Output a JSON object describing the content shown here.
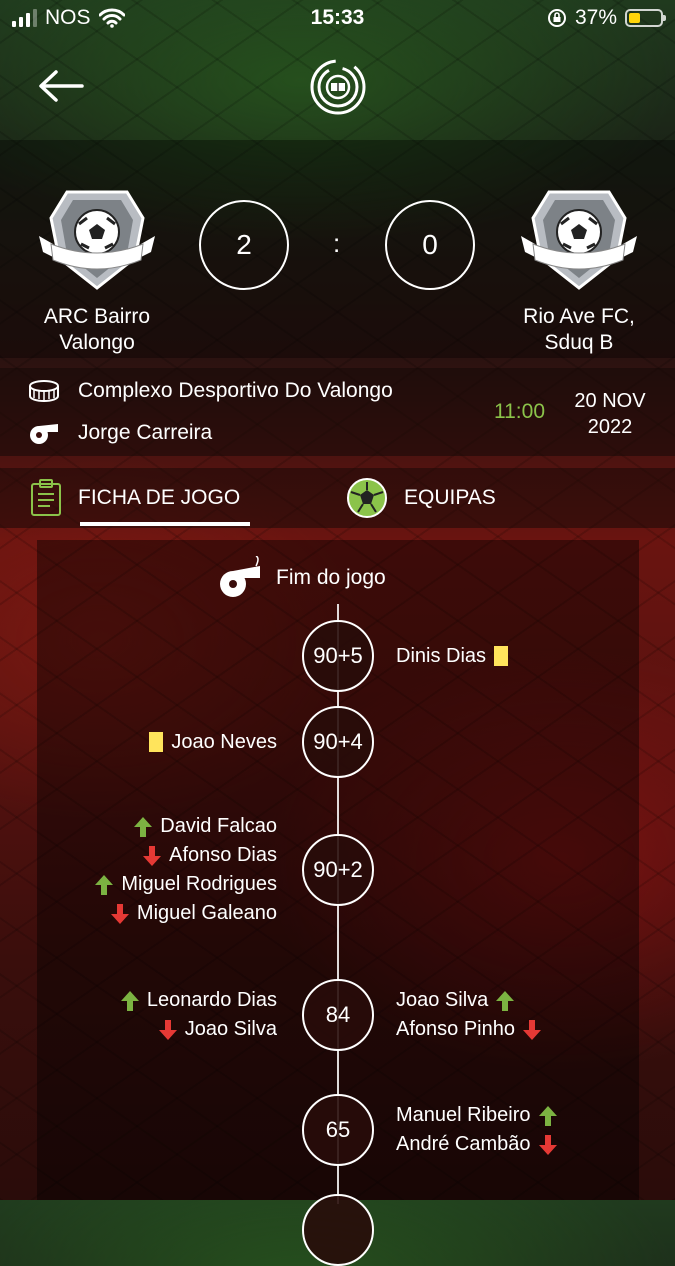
{
  "status_bar": {
    "carrier": "NOS",
    "time": "15:33",
    "battery_percent": "37%",
    "battery_level": 0.37
  },
  "header": {
    "back_icon": "arrow-left-icon",
    "logo_icon": "app-logo-icon"
  },
  "match": {
    "home_team": {
      "line1": "ARC Bairro",
      "line2": "Valongo",
      "score": "2"
    },
    "away_team": {
      "line1": "Rio Ave FC,",
      "line2": "Sduq B",
      "score": "0"
    },
    "separator": ":"
  },
  "info": {
    "venue": "Complexo Desportivo Do Valongo",
    "referee": "Jorge Carreira",
    "kickoff": "11:00",
    "date_line1": "20 NOV",
    "date_line2": "2022"
  },
  "tabs": [
    {
      "label": "FICHA DE JOGO",
      "icon": "clipboard-icon",
      "active": true
    },
    {
      "label": "EQUIPAS",
      "icon": "soccer-ball-icon",
      "active": false
    }
  ],
  "timeline": {
    "end_label": "Fim do jogo",
    "events": [
      {
        "minute": "90+5",
        "right": [
          {
            "name": "Dinis Dias",
            "type": "yellow-card"
          }
        ],
        "left": []
      },
      {
        "minute": "90+4",
        "left": [
          {
            "name": "Joao Neves",
            "type": "yellow-card"
          }
        ],
        "right": []
      },
      {
        "minute": "90+2",
        "left": [
          {
            "name": "David Falcao",
            "type": "sub-in"
          },
          {
            "name": "Afonso Dias",
            "type": "sub-out"
          },
          {
            "name": "Miguel Rodrigues",
            "type": "sub-in"
          },
          {
            "name": "Miguel Galeano",
            "type": "sub-out"
          }
        ],
        "right": []
      },
      {
        "minute": "84",
        "left": [
          {
            "name": "Leonardo Dias",
            "type": "sub-in"
          },
          {
            "name": "Joao Silva",
            "type": "sub-out"
          }
        ],
        "right": [
          {
            "name": "Joao Silva",
            "type": "sub-in"
          },
          {
            "name": "Afonso Pinho",
            "type": "sub-out"
          }
        ]
      },
      {
        "minute": "65",
        "left": [],
        "right": [
          {
            "name": "Manuel Ribeiro",
            "type": "sub-in"
          },
          {
            "name": "André Cambão",
            "type": "sub-out"
          }
        ]
      }
    ]
  },
  "colors": {
    "accent_green": "#8bc34a",
    "sub_in": "#7cb342",
    "sub_out": "#e53935",
    "yellow_card": "#ffe45c"
  }
}
